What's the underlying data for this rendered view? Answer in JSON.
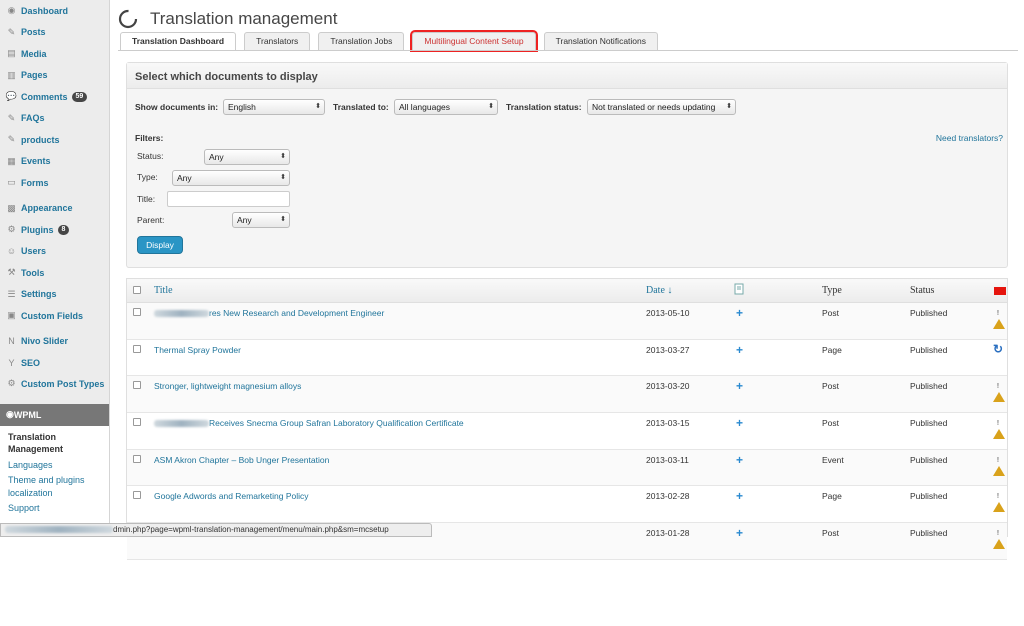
{
  "sidebar": {
    "items": [
      {
        "label": "Dashboard",
        "icon": "dashboard-icon"
      },
      {
        "label": "Posts",
        "icon": "pin-icon"
      },
      {
        "label": "Media",
        "icon": "media-icon"
      },
      {
        "label": "Pages",
        "icon": "pages-icon"
      },
      {
        "label": "Comments",
        "icon": "comments-icon",
        "badge": "59"
      },
      {
        "label": "FAQs",
        "icon": "pin-icon"
      },
      {
        "label": "products",
        "icon": "pin-icon"
      },
      {
        "label": "Events",
        "icon": "events-icon"
      },
      {
        "label": "Forms",
        "icon": "forms-icon"
      },
      {
        "label": "Appearance",
        "icon": "appearance-icon"
      },
      {
        "label": "Plugins",
        "icon": "plugins-icon",
        "badge": "8"
      },
      {
        "label": "Users",
        "icon": "users-icon"
      },
      {
        "label": "Tools",
        "icon": "tools-icon"
      },
      {
        "label": "Settings",
        "icon": "settings-icon"
      },
      {
        "label": "Custom Fields",
        "icon": "custom-fields-icon"
      },
      {
        "label": "Nivo Slider",
        "icon": "nivo-icon"
      },
      {
        "label": "SEO",
        "icon": "seo-icon"
      },
      {
        "label": "Custom Post Types",
        "icon": "gear-icon"
      }
    ],
    "wpml": {
      "label": "WPML",
      "submenu": [
        "Translation Management",
        "Languages",
        "Theme and plugins localization",
        "Support"
      ]
    }
  },
  "header": {
    "title": "Translation management"
  },
  "tabs": [
    {
      "label": "Translation Dashboard",
      "active": true
    },
    {
      "label": "Translators"
    },
    {
      "label": "Translation Jobs"
    },
    {
      "label": "Multilingual Content Setup",
      "highlight": true
    },
    {
      "label": "Translation Notifications"
    }
  ],
  "filters": {
    "heading": "Select which documents to display",
    "show_in_label": "Show documents in:",
    "show_in_value": "English",
    "translated_to_label": "Translated to:",
    "translated_to_value": "All languages",
    "status_label": "Translation status:",
    "status_value": "Not translated or needs updating",
    "filters_label": "Filters:",
    "need_translators": "Need translators?",
    "f_status_label": "Status:",
    "f_status_value": "Any",
    "f_type_label": "Type:",
    "f_type_value": "Any",
    "f_title_label": "Title:",
    "f_parent_label": "Parent:",
    "f_parent_value": "Any",
    "display_button": "Display"
  },
  "table": {
    "columns": {
      "title": "Title",
      "date": "Date ↓",
      "type": "Type",
      "status": "Status"
    },
    "rows": [
      {
        "title": "res New Research and Development Engineer",
        "blurred": true,
        "date": "2013-05-10",
        "type": "Post",
        "status": "Published",
        "icon": "warning-icon"
      },
      {
        "title": "Thermal Spray Powder",
        "blurred": false,
        "date": "2013-03-27",
        "type": "Page",
        "status": "Published",
        "icon": "refresh-icon"
      },
      {
        "title": "Stronger, lightweight magnesium alloys",
        "blurred": false,
        "date": "2013-03-20",
        "type": "Post",
        "status": "Published",
        "icon": "warning-icon"
      },
      {
        "title": "Receives Snecma Group Safran Laboratory Qualification Certificate",
        "blurred": true,
        "date": "2013-03-15",
        "type": "Post",
        "status": "Published",
        "icon": "warning-icon"
      },
      {
        "title": "ASM Akron Chapter – Bob Unger Presentation",
        "blurred": false,
        "date": "2013-03-11",
        "type": "Event",
        "status": "Published",
        "icon": "warning-icon"
      },
      {
        "title": "Google Adwords and Remarketing Policy",
        "blurred": false,
        "date": "2013-02-28",
        "type": "Page",
        "status": "Published",
        "icon": "warning-icon"
      },
      {
        "title": "",
        "blurred": false,
        "date": "2013-01-28",
        "type": "Post",
        "status": "Published",
        "icon": "warning-icon"
      }
    ]
  },
  "status_bar": {
    "url": "dmin.php?page=wpml-translation-management/menu/main.php&sm=mcsetup"
  }
}
